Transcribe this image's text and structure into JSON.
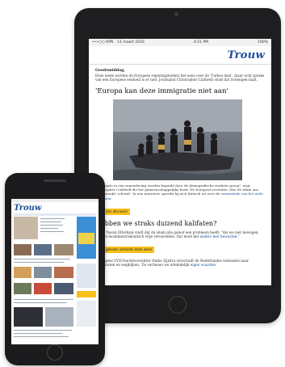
{
  "ipad": {
    "status_left": [
      "•••○○ KPN",
      "11 maart 2016"
    ],
    "status_time": "4:21 PM",
    "status_right": "100%",
    "logo": "Trouw",
    "greeting": "Goedemiddag,",
    "intro": "Deze week worden de Europese regeringsleiders het eens over de 'Turkse deal', maar echt sprake van een Europese eenheid is er niet. Journalist Christopher Caldwell vindt dat Schengen faalt.",
    "headline": "'Europa kan deze immigratie niet aan'",
    "caption_text": "\"De regels in een samenleving worden bepaald door de demografische sterkste groep\", zegt Christopher Caldwell die het gemeenschappelijke boek 'De Europese revolutie. Hoe de islam ons oversprankt' schreef. 'In een interview spreekt hij zich kritisch uit over de ",
    "caption_link": "vermindrde van het oude continent.",
    "tag1": "Voor ons discussie",
    "h2": "Hebben we straks duizend kalifaten?",
    "p2_text": "Imam Yassin Elforkani vindt dat de islam alle geloof een probleem heeft: \"Als we niet bewegen, zijn we moslimextremistisch vrije veroordelen. Dat moet het ",
    "p2_link": "anders met bewusten.\"",
    "tag2": "Best gelezen artikelen deze week",
    "p3_text": "1. Volgens VVD-fractievoorzitter Halbe Zijlstra verschuift de Nederlandse tolerantie naar goedpraten en wegkijken. 'Ze verliezen we uiteindelijk ",
    "p3_link": "eigen waarden.'"
  },
  "iphone": {
    "logo": "Trouw"
  },
  "colors": {
    "brand_blue": "#1a4e9b",
    "tag_yellow": "#f7c11c",
    "device_body": "#1e1e20"
  }
}
